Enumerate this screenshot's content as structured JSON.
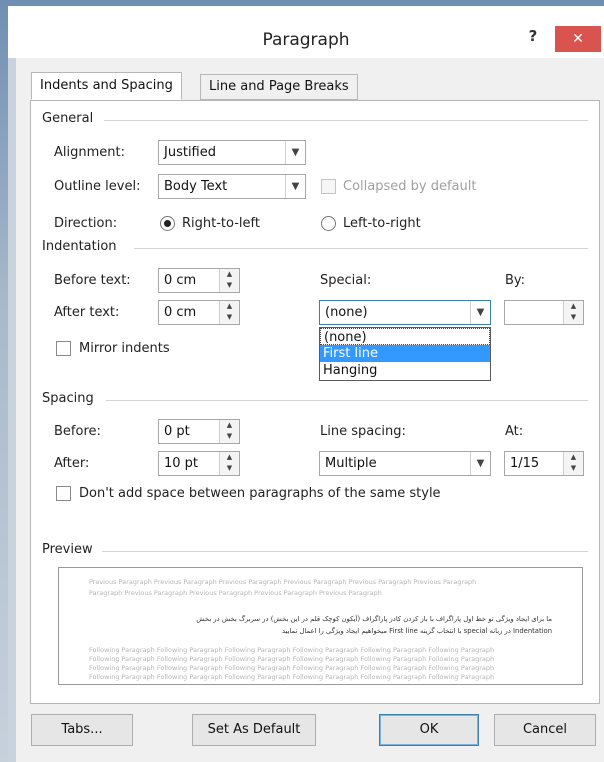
{
  "dialog": {
    "title": "Paragraph",
    "help": "?",
    "close": "✕"
  },
  "tabs": [
    {
      "label": "Indents and Spacing",
      "active": true
    },
    {
      "label": "Line and Page Breaks",
      "active": false
    }
  ],
  "general": {
    "section": "General",
    "alignment_label": "Alignment:",
    "alignment_value": "Justified",
    "outline_label": "Outline level:",
    "outline_value": "Body Text",
    "collapsed_label": "Collapsed by default",
    "direction_label": "Direction:",
    "rtl_label": "Right-to-left",
    "ltr_label": "Left-to-right",
    "direction_selected": "Right-to-left"
  },
  "indentation": {
    "section": "Indentation",
    "before_label": "Before text:",
    "before_value": "0 cm",
    "after_label": "After text:",
    "after_value": "0 cm",
    "special_label": "Special:",
    "special_value": "(none)",
    "by_label": "By:",
    "by_value": "",
    "mirror_label": "Mirror indents",
    "special_options": [
      "(none)",
      "First line",
      "Hanging"
    ],
    "special_highlighted": "First line"
  },
  "spacing": {
    "section": "Spacing",
    "before_label": "Before:",
    "before_value": "0 pt",
    "after_label": "After:",
    "after_value": "10 pt",
    "line_spacing_label": "Line spacing:",
    "line_spacing_value": "Multiple",
    "at_label": "At:",
    "at_value": "1/15",
    "dont_add_label": "Don't add space between paragraphs of the same style"
  },
  "preview": {
    "section": "Preview",
    "prev_line1": "Previous Paragraph Previous Paragraph Previous Paragraph Previous Paragraph Previous Paragraph Previous Paragraph",
    "prev_line2": "Paragraph Previous Paragraph Previous Paragraph Previous Paragraph Previous Paragraph",
    "sample_line1": "ما برای ایجاد ویژگی تو خط اول پاراگراف با باز کردن کادر پاراگراف (آیکون کوچک قلم در این بخش) در سربرگ بخش در بخش",
    "sample_line2": "Indentation در زبانه special با انتخاب گزینه First line میخواهیم ایجاد ویژگی را اعمال نمایید",
    "follow_line1": "Following Paragraph Following Paragraph Following Paragraph Following Paragraph Following Paragraph Following Paragraph",
    "follow_line2": "Following Paragraph Following Paragraph Following Paragraph Following Paragraph Following Paragraph Following Paragraph",
    "follow_line3": "Following Paragraph Following Paragraph Following Paragraph Following Paragraph Following Paragraph Following Paragraph",
    "follow_line4": "Following Paragraph Following Paragraph Following Paragraph Following Paragraph Following Paragraph Following Paragraph",
    "follow_line5": "Following Paragraph Following Paragraph Following Paragraph Following Paragraph Following Paragraph Following Paragraph"
  },
  "buttons": {
    "tabs": "Tabs...",
    "set_default": "Set As Default",
    "ok": "OK",
    "cancel": "Cancel"
  },
  "colors": {
    "close_button": "#d9534f",
    "highlight": "#3399ff",
    "dialog_background": "#f0f0f0"
  }
}
